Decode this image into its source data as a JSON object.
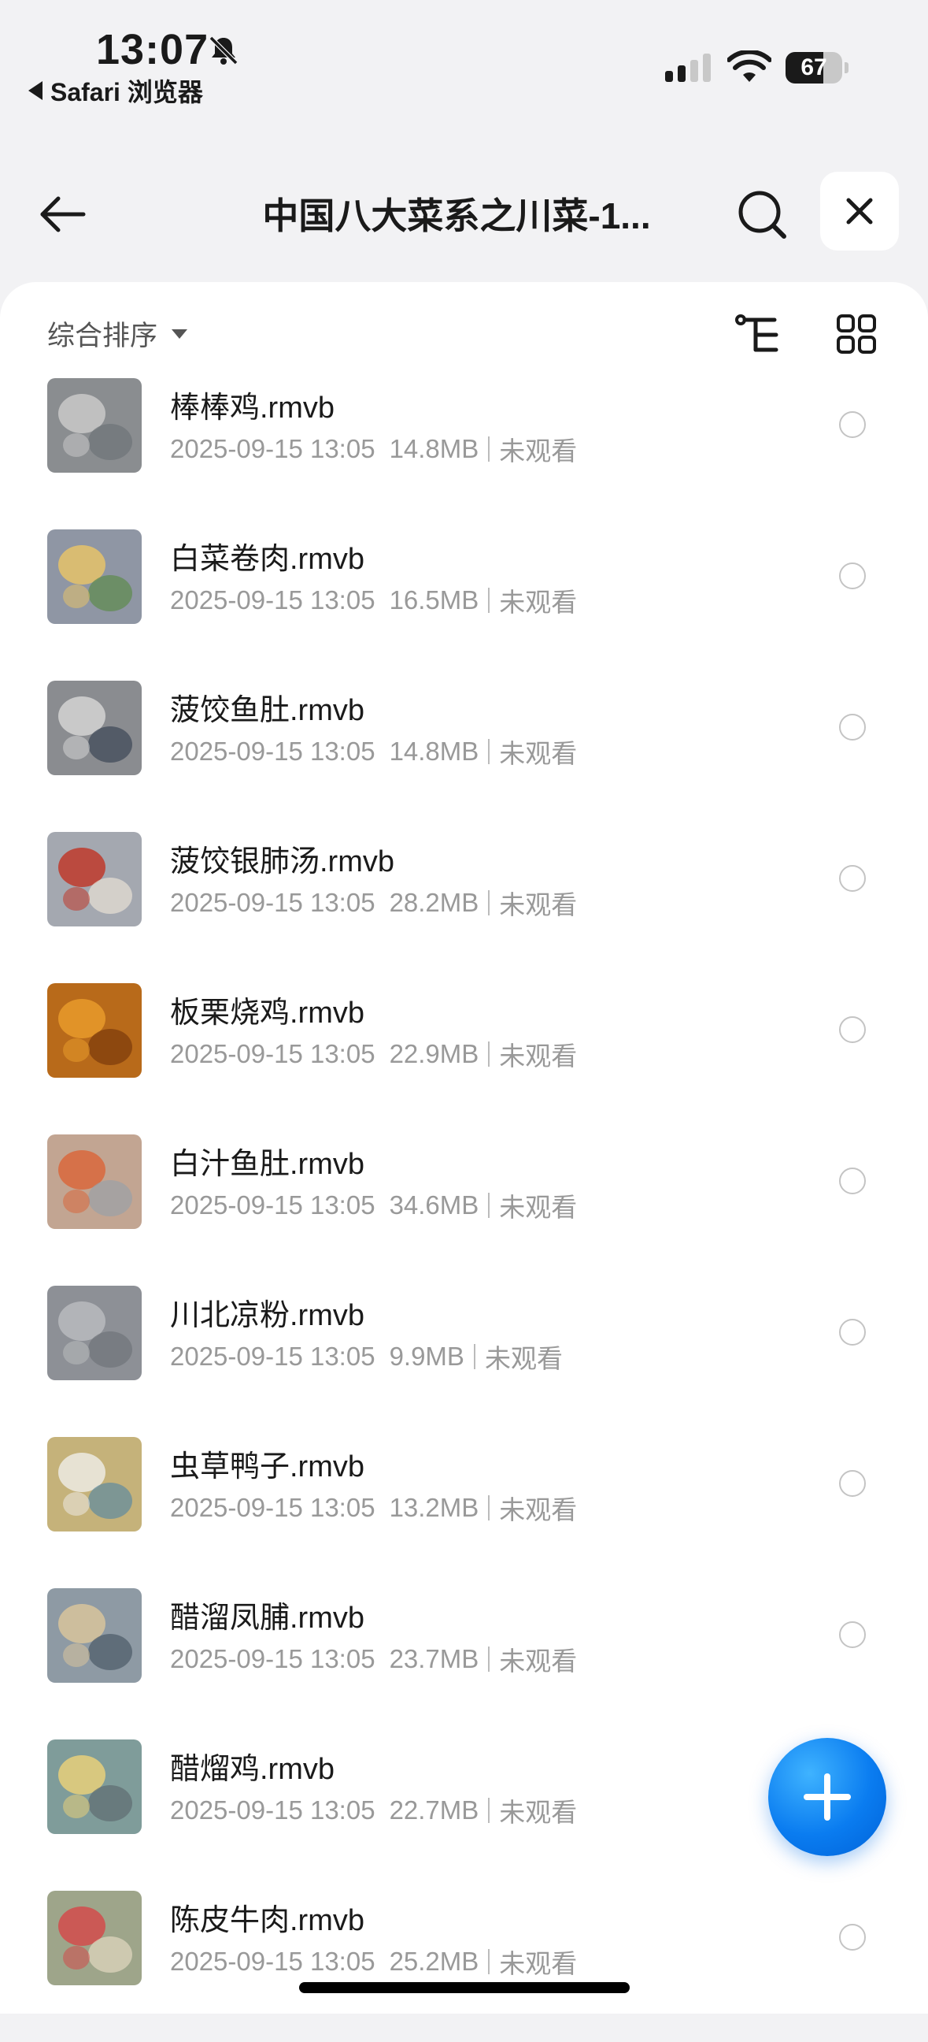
{
  "status_bar": {
    "time": "13:07",
    "back_app": "Safari 浏览器",
    "battery": 67,
    "icons": [
      "bell-slash-icon",
      "signal-icon",
      "wifi-icon",
      "battery-icon"
    ]
  },
  "header": {
    "title": "中国八大菜系之川菜-1...",
    "icons": [
      "back-arrow-icon",
      "search-icon",
      "close-icon"
    ]
  },
  "toolbar": {
    "sort_label": "综合排序",
    "icons": [
      "tree-view-icon",
      "grid-view-icon"
    ]
  },
  "files": [
    {
      "name": "棒棒鸡.rmvb",
      "date": "2025-09-15 13:05",
      "size": "14.8MB",
      "status": "未观看"
    },
    {
      "name": "白菜卷肉.rmvb",
      "date": "2025-09-15 13:05",
      "size": "16.5MB",
      "status": "未观看"
    },
    {
      "name": "菠饺鱼肚.rmvb",
      "date": "2025-09-15 13:05",
      "size": "14.8MB",
      "status": "未观看"
    },
    {
      "name": "菠饺银肺汤.rmvb",
      "date": "2025-09-15 13:05",
      "size": "28.2MB",
      "status": "未观看"
    },
    {
      "name": "板栗烧鸡.rmvb",
      "date": "2025-09-15 13:05",
      "size": "22.9MB",
      "status": "未观看"
    },
    {
      "name": "白汁鱼肚.rmvb",
      "date": "2025-09-15 13:05",
      "size": "34.6MB",
      "status": "未观看"
    },
    {
      "name": "川北凉粉.rmvb",
      "date": "2025-09-15 13:05",
      "size": "9.9MB",
      "status": "未观看"
    },
    {
      "name": "虫草鸭子.rmvb",
      "date": "2025-09-15 13:05",
      "size": "13.2MB",
      "status": "未观看"
    },
    {
      "name": "醋溜凤脯.rmvb",
      "date": "2025-09-15 13:05",
      "size": "23.7MB",
      "status": "未观看"
    },
    {
      "name": "醋熘鸡.rmvb",
      "date": "2025-09-15 13:05",
      "size": "22.7MB",
      "status": "未观看"
    },
    {
      "name": "陈皮牛肉.rmvb",
      "date": "2025-09-15 13:05",
      "size": "25.2MB",
      "status": "未观看"
    }
  ],
  "thumb_colors": [
    [
      "#8a8d90",
      "#c9c9c9",
      "#6e7378"
    ],
    [
      "#8f96a4",
      "#e6c36a",
      "#5d8a4c"
    ],
    [
      "#8a8c90",
      "#d4d4d4",
      "#3c4656"
    ],
    [
      "#a4a8b0",
      "#c0392b",
      "#e8e1d6"
    ],
    [
      "#b86a1a",
      "#e89a2c",
      "#7a3a0c"
    ],
    [
      "#c2a592",
      "#d9673c",
      "#9aa1a8"
    ],
    [
      "#8d9096",
      "#b9bbbe",
      "#6f7479"
    ],
    [
      "#c5b27a",
      "#eceae3",
      "#5e8aa0"
    ],
    [
      "#8e9aa4",
      "#d8c49c",
      "#4b5a66"
    ],
    [
      "#7f9c9a",
      "#e8d07a",
      "#5e6c70"
    ],
    [
      "#9ea58a",
      "#d24b4b",
      "#e3d9c1"
    ]
  ],
  "fab": {
    "icon": "plus-icon"
  }
}
